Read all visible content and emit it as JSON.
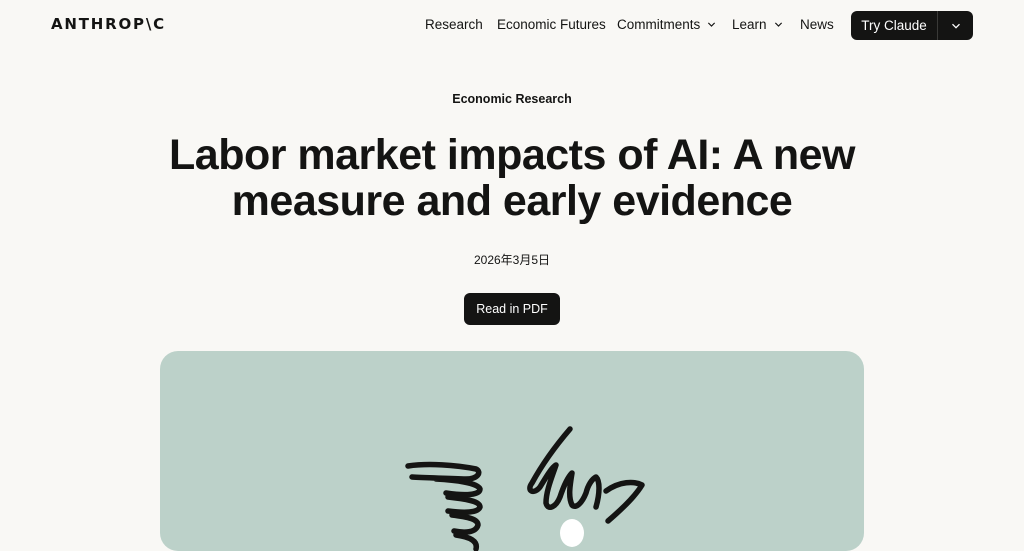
{
  "header": {
    "logo": "ANTHROP\\C",
    "nav": [
      {
        "label": "Research",
        "dropdown": false
      },
      {
        "label": "Economic Futures",
        "dropdown": false
      },
      {
        "label": "Commitments",
        "dropdown": true
      },
      {
        "label": "Learn",
        "dropdown": true
      },
      {
        "label": "News",
        "dropdown": false
      }
    ],
    "cta_label": "Try Claude"
  },
  "article": {
    "category": "Economic Research",
    "title": "Labor market impacts of AI: A new measure and early evidence",
    "date": "2026年3月5日",
    "pdf_button": "Read in PDF"
  },
  "hero_image": {
    "background_color": "#bcd1c9",
    "illustration": "hand-drawn-hands-illustration"
  },
  "colors": {
    "page_background": "#f9f8f5",
    "text": "#141413",
    "button_background": "#141413"
  }
}
